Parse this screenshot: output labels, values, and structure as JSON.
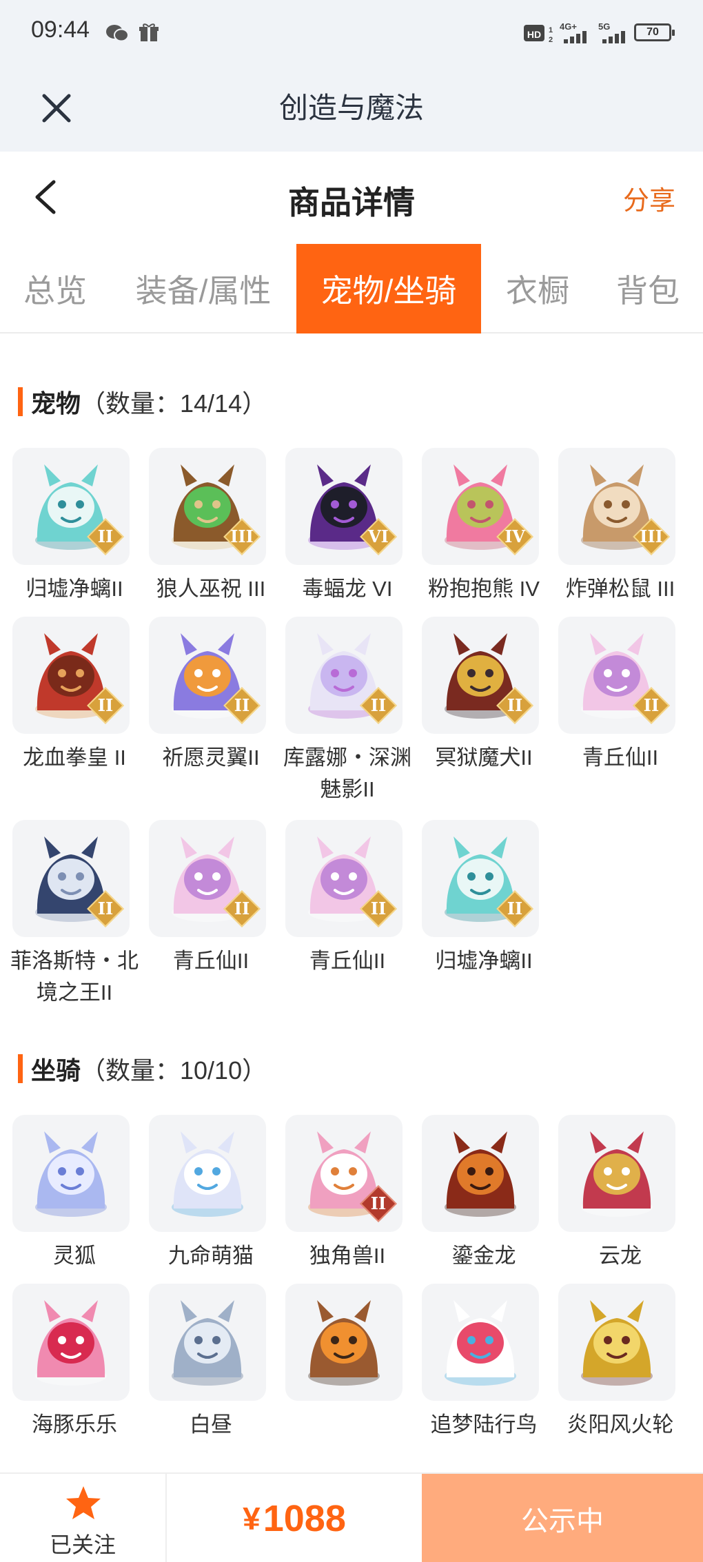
{
  "status": {
    "time": "09:44",
    "battery": "70",
    "hd": "HD",
    "net1": "4G+",
    "net2": "5G"
  },
  "app": {
    "title": "创造与魔法"
  },
  "header": {
    "title": "商品详情",
    "share": "分享"
  },
  "tabs": [
    {
      "label": "总览"
    },
    {
      "label": "装备/属性"
    },
    {
      "label": "宠物/坐骑"
    },
    {
      "label": "衣橱"
    },
    {
      "label": "背包"
    }
  ],
  "pets": {
    "title": "宠物",
    "count": "（数量：14/14）",
    "items": [
      {
        "name": "归墟净螭II",
        "tier": "II"
      },
      {
        "name": "狼人巫祝 III",
        "tier": "III"
      },
      {
        "name": "毒蝠龙 VI",
        "tier": "VI"
      },
      {
        "name": "粉抱抱熊 IV",
        "tier": "IV"
      },
      {
        "name": "炸弹松鼠 III",
        "tier": "III"
      },
      {
        "name": "龙血拳皇 II",
        "tier": "II"
      },
      {
        "name": "祈愿灵翼II",
        "tier": "II"
      },
      {
        "name": "库露娜・深渊魅影II",
        "tier": "II"
      },
      {
        "name": "冥狱魔犬II",
        "tier": "II"
      },
      {
        "name": "青丘仙II",
        "tier": "II"
      },
      {
        "name": "菲洛斯特・北境之王II",
        "tier": "II"
      },
      {
        "name": "青丘仙II",
        "tier": "II"
      },
      {
        "name": "青丘仙II",
        "tier": "II"
      },
      {
        "name": "归墟净螭II",
        "tier": "II"
      }
    ]
  },
  "mounts": {
    "title": "坐骑",
    "count": "（数量：10/10）",
    "items": [
      {
        "name": "灵狐",
        "tier": ""
      },
      {
        "name": "九命萌猫",
        "tier": ""
      },
      {
        "name": "独角兽II",
        "tier": "II"
      },
      {
        "name": "鎏金龙",
        "tier": ""
      },
      {
        "name": "云龙",
        "tier": ""
      },
      {
        "name": "海豚乐乐",
        "tier": ""
      },
      {
        "name": "白昼",
        "tier": ""
      },
      {
        "name": "",
        "tier": ""
      },
      {
        "name": "追梦陆行鸟",
        "tier": ""
      },
      {
        "name": "炎阳风火轮",
        "tier": ""
      }
    ]
  },
  "footer": {
    "follow": "已关注",
    "currency": "¥",
    "price": "1088",
    "status_button": "公示中"
  },
  "colors": {
    "accent": "#ff6412",
    "share": "#e86a1c",
    "button": "#ffab7d"
  }
}
